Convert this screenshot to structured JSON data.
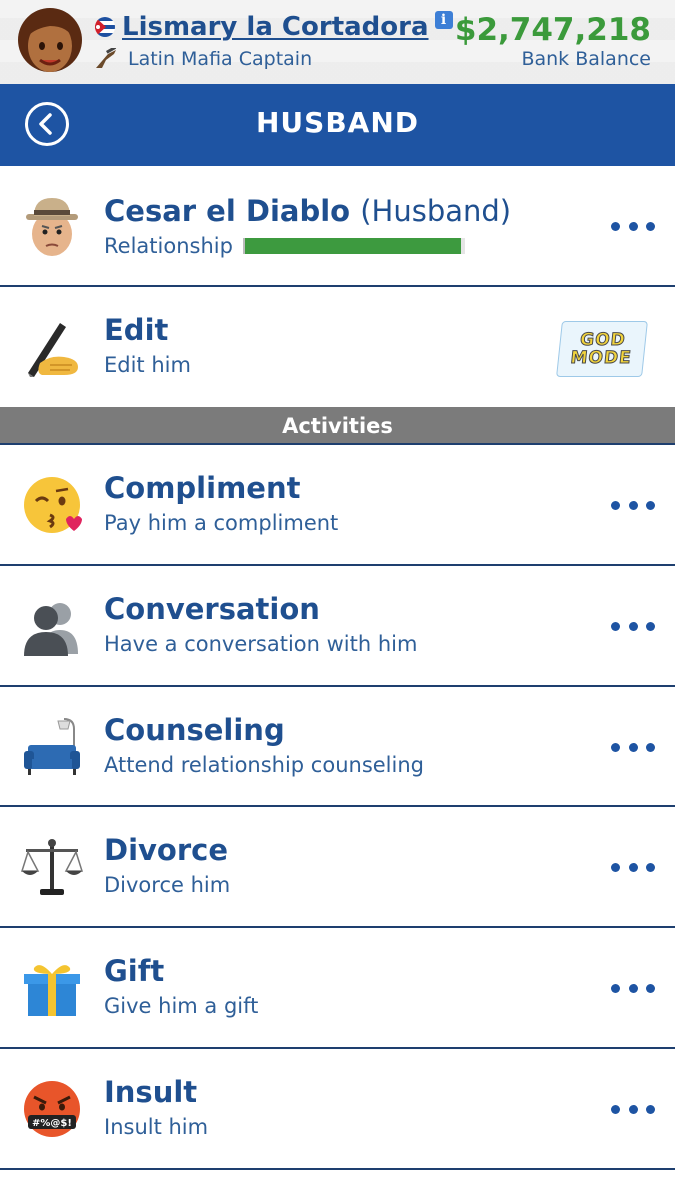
{
  "profile": {
    "name": "Lismary la Cortadora",
    "info_icon_text": "i",
    "title": "Latin Mafia Captain",
    "balance": "$2,747,218",
    "balance_label": "Bank Balance"
  },
  "header": {
    "title": "HUSBAND"
  },
  "spouse": {
    "name": "Cesar el Diablo",
    "relation": "(Husband)",
    "relationship_label": "Relationship",
    "relationship_level": 0.98
  },
  "edit": {
    "label": "Edit",
    "sub": "Edit him",
    "badge_line1": "GOD",
    "badge_line2": "MODE"
  },
  "section": {
    "title": "Activities"
  },
  "activities": [
    {
      "label": "Compliment",
      "sub": "Pay him a compliment",
      "icon": "kissing-face-icon"
    },
    {
      "label": "Conversation",
      "sub": "Have a conversation with him",
      "icon": "people-silhouette-icon"
    },
    {
      "label": "Counseling",
      "sub": "Attend relationship counseling",
      "icon": "couch-icon"
    },
    {
      "label": "Divorce",
      "sub": "Divorce him",
      "icon": "scales-icon"
    },
    {
      "label": "Gift",
      "sub": "Give him a gift",
      "icon": "gift-icon"
    },
    {
      "label": "Insult",
      "sub": "Insult him",
      "icon": "angry-face-icon"
    }
  ],
  "colors": {
    "brand_blue": "#1e54a3",
    "money_green": "#3b9a3b",
    "relationship_green": "#3d9a3f",
    "section_gray": "#7b7b7b"
  }
}
